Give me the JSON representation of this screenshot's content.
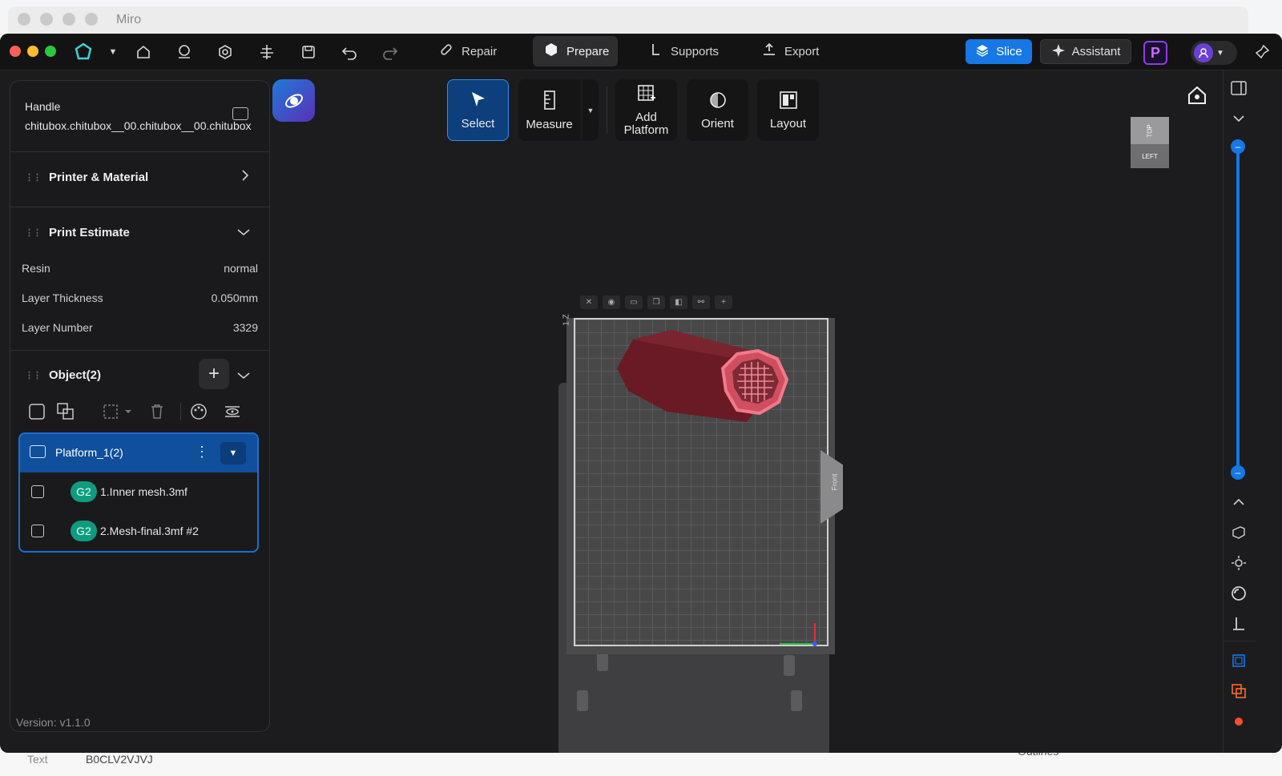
{
  "background_window": {
    "title": "Miro",
    "bottom_label": "Text",
    "bottom_value": "B0CLV2VJVJ",
    "outlines_label": "Outlines"
  },
  "topbar": {
    "tabs": {
      "repair": "Repair",
      "prepare": "Prepare",
      "supports": "Supports",
      "export": "Export"
    },
    "slice_label": "Slice",
    "assistant_label": "Assistant",
    "p_logo": "P"
  },
  "left_panel": {
    "file_name": "Handle chitubox.chitubox__00.chitubox__00.chitubox",
    "printer_material": "Printer & Material",
    "print_estimate": {
      "title": "Print Estimate",
      "rows": [
        {
          "label": "Resin",
          "value": "normal"
        },
        {
          "label": "Layer Thickness",
          "value": "0.050mm"
        },
        {
          "label": "Layer Number",
          "value": "3329"
        }
      ]
    },
    "objects": {
      "title": "Object(2)",
      "platform": "Platform_1(2)",
      "items": [
        {
          "badge": "G2",
          "name": "1.Inner mesh.3mf"
        },
        {
          "badge": "G2",
          "name": "2.Mesh-final.3mf #2"
        }
      ]
    },
    "version": "Version: v1.1.0"
  },
  "viewport": {
    "tools": {
      "select": "Select",
      "measure": "Measure",
      "add_platform": "Add Platform",
      "orient": "Orient",
      "layout": "Layout"
    },
    "view_cube": {
      "top": "TOP",
      "left": "LEFT"
    },
    "front_label": "Front",
    "side_label": "1 Z"
  },
  "colors": {
    "accent": "#1677e6",
    "selected_object": "#e8607a",
    "badge": "#0f9c7e"
  }
}
